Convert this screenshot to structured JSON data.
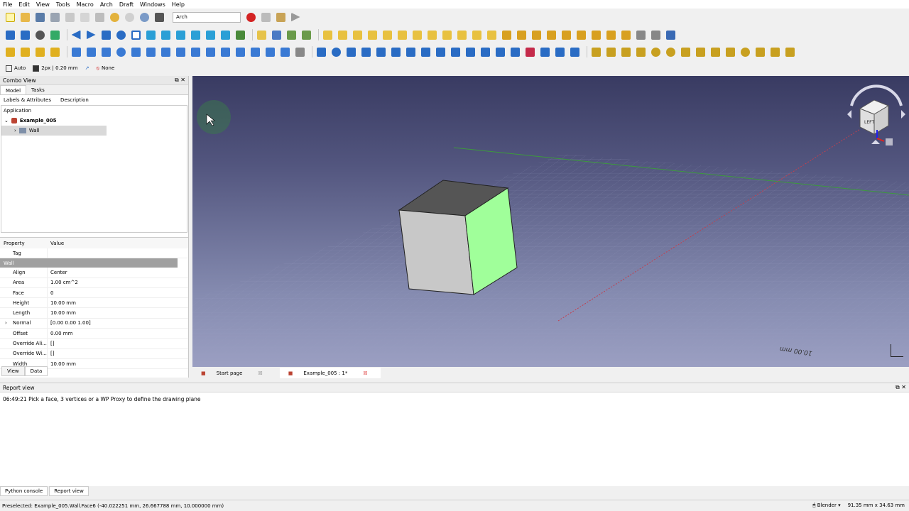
{
  "menu": [
    "File",
    "Edit",
    "View",
    "Tools",
    "Macro",
    "Arch",
    "Draft",
    "Windows",
    "Help"
  ],
  "workbench": "Arch",
  "snapbar": {
    "auto": "Auto",
    "linewidth": "2px | 0.20 mm",
    "none": "None"
  },
  "combo": {
    "title": "Combo View",
    "tabs": [
      "Model",
      "Tasks"
    ],
    "tree_cols": [
      "Labels & Attributes",
      "Description"
    ],
    "app_label": "Application",
    "doc": "Example_005",
    "item": "Wall"
  },
  "props": {
    "cols": [
      "Property",
      "Value"
    ],
    "tag_row": "Tag",
    "group": "Wall",
    "rows": [
      {
        "name": "Align",
        "value": "Center"
      },
      {
        "name": "Area",
        "value": "1.00 cm^2"
      },
      {
        "name": "Face",
        "value": "0"
      },
      {
        "name": "Height",
        "value": "10.00 mm"
      },
      {
        "name": "Length",
        "value": "10.00 mm"
      },
      {
        "name": "Normal",
        "value": "[0.00 0.00 1.00]"
      },
      {
        "name": "Offset",
        "value": "0.00 mm"
      },
      {
        "name": "Override Ali...",
        "value": "[]"
      },
      {
        "name": "Override Wi...",
        "value": "[]"
      },
      {
        "name": "Width",
        "value": "10.00 mm"
      }
    ],
    "bottom_tabs": [
      "View",
      "Data"
    ]
  },
  "viewport": {
    "scale_label": "10.00 mm",
    "navcube_face": "LEFT",
    "navcube_right": "FRONT"
  },
  "doc_tabs": [
    "Start page",
    "Example_005 : 1*"
  ],
  "report": {
    "title": "Report view",
    "message": "06:49:21  Pick a face, 3 vertices or a WP Proxy to define the drawing plane"
  },
  "report_tabs": [
    "Python console",
    "Report view"
  ],
  "status": {
    "preselect": "Preselected: Example_005.Wall.Face6 (-40.022251 mm, 26.667788 mm, 10.000000 mm)",
    "nav": "Blender",
    "dims": "91.35 mm x 34.63 mm"
  },
  "colors": {
    "accent": "#2266cc",
    "selected_face": "#a0ff9a",
    "tree_highlight": "#d9d9d9"
  }
}
